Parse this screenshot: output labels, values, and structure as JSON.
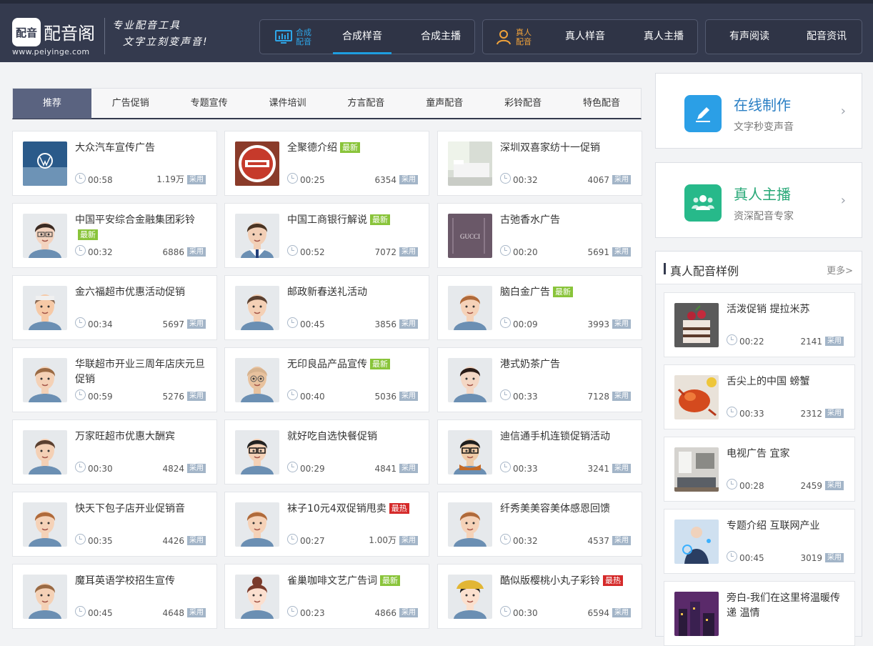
{
  "brand": {
    "name": "配音阁",
    "url": "www.peiyinge.com",
    "logo_glyph": "配音",
    "slogan_line1": "专业配音工具",
    "slogan_line2": "文字立刻变声音!"
  },
  "nav": {
    "group1": {
      "caption1": "合成",
      "caption2": "配音",
      "icon": "monitor-icon",
      "items": [
        "合成样音",
        "合成主播"
      ]
    },
    "group2": {
      "caption1": "真人",
      "caption2": "配音",
      "icon": "person-icon",
      "items": [
        "真人样音",
        "真人主播"
      ]
    },
    "group3": {
      "items": [
        "有声阅读",
        "配音资讯"
      ]
    }
  },
  "tabs": [
    "推荐",
    "广告促销",
    "专题宣传",
    "课件培训",
    "方言配音",
    "童声配音",
    "彩铃配音",
    "特色配音"
  ],
  "cards": [
    {
      "title": "大众汽车宣传广告",
      "badge": "",
      "duration": "00:58",
      "count": "1.19万",
      "thumb": "logo"
    },
    {
      "title": "全聚德介绍",
      "badge": "最新",
      "duration": "00:25",
      "count": "6354",
      "thumb": "plate"
    },
    {
      "title": "深圳双喜家纺十一促销",
      "badge": "",
      "duration": "00:32",
      "count": "4067",
      "thumb": "room"
    },
    {
      "title": "中国平安综合金融集团彩铃",
      "badge": "最新",
      "duration": "00:32",
      "count": "6886",
      "thumb": "woman-glasses"
    },
    {
      "title": "中国工商银行解说",
      "badge": "最新",
      "duration": "00:52",
      "count": "7072",
      "thumb": "man-suit"
    },
    {
      "title": "古弛香水广告",
      "badge": "",
      "duration": "00:20",
      "count": "5691",
      "thumb": "gucci"
    },
    {
      "title": "金六福超市优惠活动促销",
      "badge": "",
      "duration": "00:34",
      "count": "5697",
      "thumb": "man-chubby"
    },
    {
      "title": "邮政新春送礼活动",
      "badge": "",
      "duration": "00:45",
      "count": "3856",
      "thumb": "man"
    },
    {
      "title": "脑白金广告",
      "badge": "最新",
      "duration": "00:09",
      "count": "3993",
      "thumb": "boy"
    },
    {
      "title": "华联超市开业三周年店庆元旦促销",
      "badge": "",
      "duration": "00:59",
      "count": "5276",
      "thumb": "woman"
    },
    {
      "title": "无印良品产品宣传",
      "badge": "最新",
      "duration": "00:40",
      "count": "5036",
      "thumb": "oldman"
    },
    {
      "title": "港式奶茶广告",
      "badge": "",
      "duration": "00:33",
      "count": "7128",
      "thumb": "woman-dark"
    },
    {
      "title": "万家旺超市优惠大酬宾",
      "badge": "",
      "duration": "00:30",
      "count": "4824",
      "thumb": "man"
    },
    {
      "title": "就好吃自选快餐促销",
      "badge": "",
      "duration": "00:29",
      "count": "4841",
      "thumb": "man-glasses"
    },
    {
      "title": "迪信通手机连锁促销活动",
      "badge": "",
      "duration": "00:33",
      "count": "3241",
      "thumb": "man-scarf"
    },
    {
      "title": "快天下包子店开业促销音",
      "badge": "",
      "duration": "00:35",
      "count": "4426",
      "thumb": "boy"
    },
    {
      "title": "袜子10元4双促销甩卖",
      "badge": "最热",
      "duration": "00:27",
      "count": "1.00万",
      "thumb": "boy"
    },
    {
      "title": "纤秀美美容美体感恩回馈",
      "badge": "",
      "duration": "00:32",
      "count": "4537",
      "thumb": "boy"
    },
    {
      "title": "魔耳英语学校招生宣传",
      "badge": "",
      "duration": "00:45",
      "count": "4648",
      "thumb": "woman"
    },
    {
      "title": "雀巢咖啡文艺广告词",
      "badge": "最新",
      "duration": "00:23",
      "count": "4866",
      "thumb": "girl-anime"
    },
    {
      "title": "酷似版樱桃小丸子彩铃",
      "badge": "最热",
      "duration": "00:30",
      "count": "6594",
      "thumb": "girl-hat"
    }
  ],
  "use_label": "采用",
  "side": {
    "online": {
      "title": "在线制作",
      "subtitle": "文字秒变声音",
      "icon": "pencil-icon",
      "color": "#2b9fe6"
    },
    "anchor": {
      "title": "真人主播",
      "subtitle": "资深配音专家",
      "icon": "people-icon",
      "color": "#27b98a"
    },
    "arrow": "›"
  },
  "samples": {
    "title": "真人配音样例",
    "more": "更多>",
    "items": [
      {
        "title": "活泼促销 提拉米苏",
        "duration": "00:22",
        "count": "2141",
        "thumb": "cake"
      },
      {
        "title": "舌尖上的中国 螃蟹",
        "duration": "00:33",
        "count": "2312",
        "thumb": "crab"
      },
      {
        "title": "电视广告 宜家",
        "duration": "00:28",
        "count": "2459",
        "thumb": "interior"
      },
      {
        "title": "专题介绍 互联网产业",
        "duration": "00:45",
        "count": "3019",
        "thumb": "tech"
      },
      {
        "title": "旁白-我们在这里将温暖传递 温情",
        "duration": "",
        "count": "",
        "thumb": "city"
      }
    ]
  }
}
